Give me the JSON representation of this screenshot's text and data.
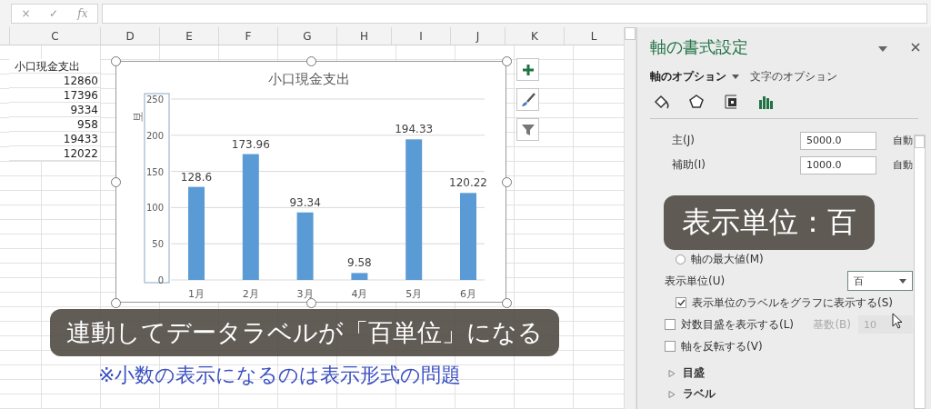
{
  "formula_bar": {
    "cancel": "×",
    "enter": "✓",
    "function": "fx"
  },
  "sheet": {
    "columns": [
      "C",
      "D",
      "E",
      "F",
      "G",
      "H",
      "I",
      "J",
      "K",
      "L"
    ],
    "cells": [
      "小口現金支出",
      "12860",
      "17396",
      "9334",
      "958",
      "19433",
      "12022"
    ]
  },
  "chart": {
    "chart_data": {
      "type": "bar",
      "title": "小口現金支出",
      "ylabel": "百",
      "categories": [
        "1月",
        "2月",
        "3月",
        "4月",
        "5月",
        "6月"
      ],
      "series": [
        {
          "color": "#5b9bd5",
          "values": [
            128.6,
            173.96,
            93.34,
            9.58,
            194.33,
            120.22
          ]
        }
      ],
      "ylim": [
        0,
        250
      ],
      "yticks": [
        0,
        50,
        100,
        150,
        200,
        250
      ],
      "data_labels": true,
      "grid": true
    },
    "axis_selected": true
  },
  "pane": {
    "title": "軸の書式設定",
    "tabs": [
      {
        "label": "軸のオプション",
        "selected": true
      },
      {
        "label": "文字のオプション",
        "selected": false
      }
    ],
    "icon_tabs": [
      {
        "kind": "fill",
        "selected": false
      },
      {
        "kind": "effects",
        "selected": false
      },
      {
        "kind": "size",
        "selected": false
      },
      {
        "kind": "options",
        "selected": true
      }
    ],
    "fields": [
      {
        "label": "主(J)",
        "value": "5000.0",
        "note": "自動"
      },
      {
        "label": "補助(I)",
        "value": "1000.0",
        "note": "自動"
      }
    ],
    "radio": {
      "label": "軸の最大値(M)",
      "selected": false
    },
    "display_unit": {
      "label": "表示単位(U)",
      "value": "百"
    },
    "checkboxes": [
      {
        "label": "表示単位のラベルをグラフに表示する(S)",
        "checked": true,
        "indent": true
      },
      {
        "label": "対数目盛を表示する(L)",
        "checked": false,
        "indent": false,
        "base_label": "基数(B)",
        "base_value": "10"
      },
      {
        "label": "軸を反転する(V)",
        "checked": false,
        "indent": false
      }
    ],
    "sections": [
      {
        "label": "目盛",
        "expanded": false
      },
      {
        "label": "ラベル",
        "expanded": false
      }
    ]
  },
  "captions": [
    {
      "kind": "box",
      "text": "表示単位：百"
    },
    {
      "kind": "box",
      "text": "連動してデータラベルが「百単位」になる"
    },
    {
      "kind": "note",
      "text": "※小数の表示になるのは表示形式の問題"
    }
  ]
}
